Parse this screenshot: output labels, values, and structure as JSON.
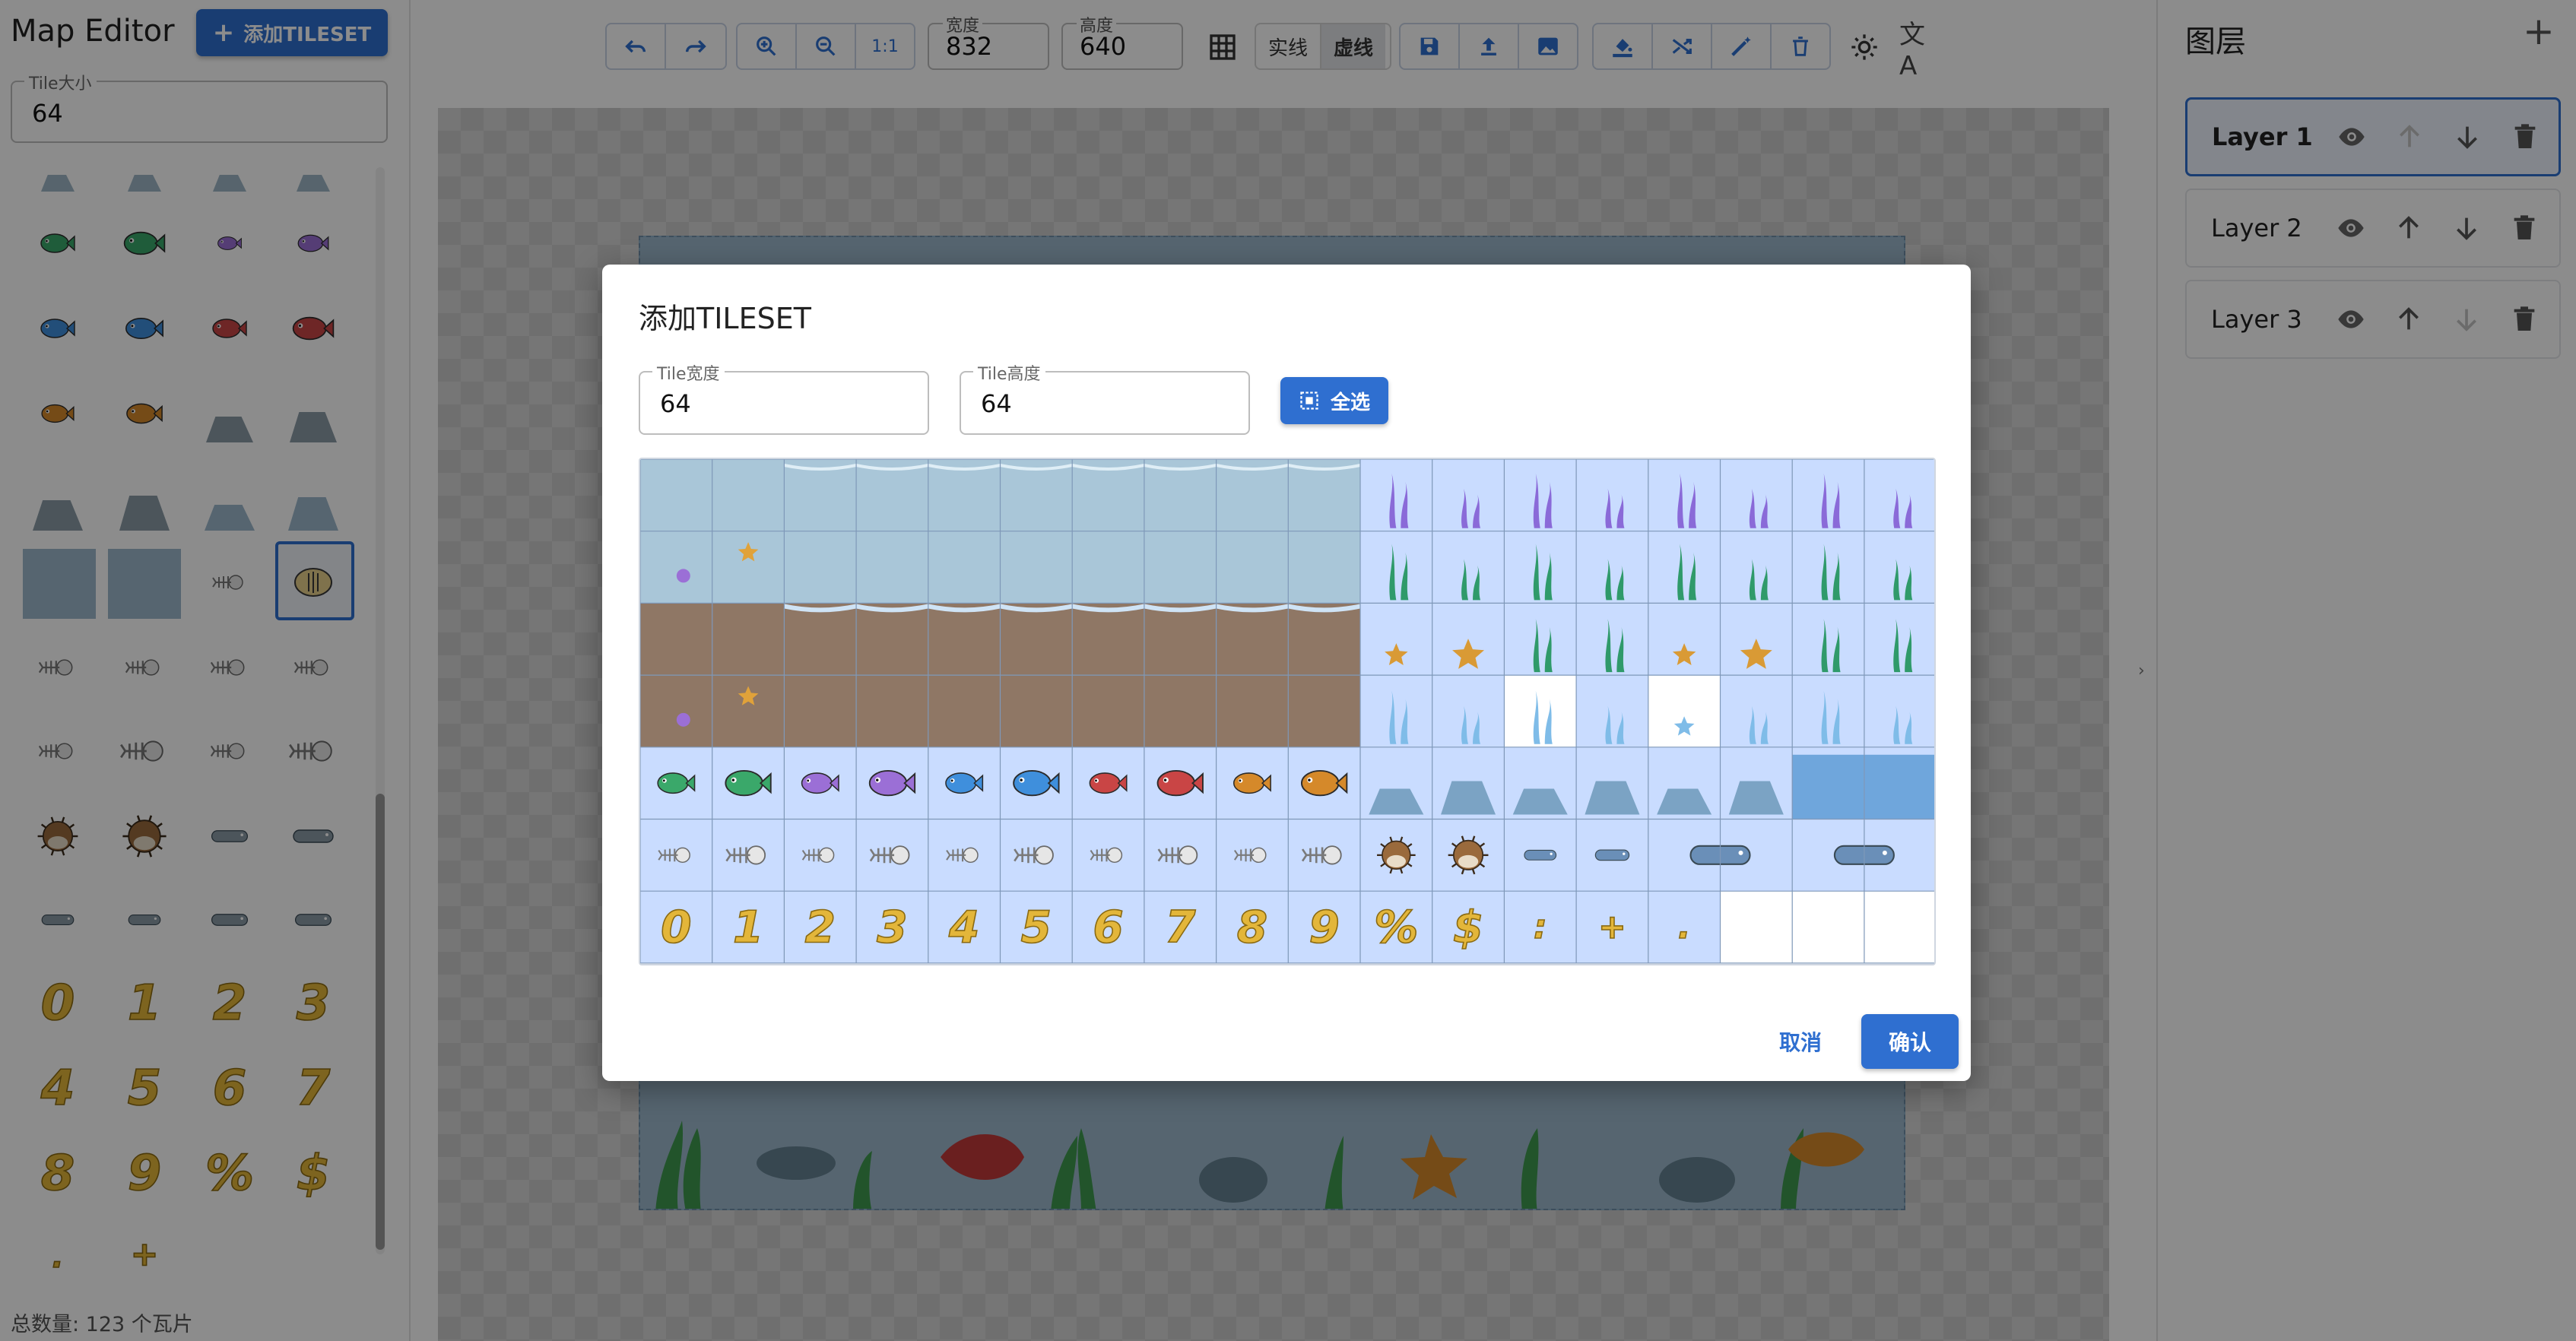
{
  "app": {
    "title": "Map Editor",
    "add_tileset_label": "添加TILESET"
  },
  "sidebar": {
    "tile_size": {
      "label": "Tile大小",
      "value": "64"
    },
    "total": "总数量: 123 个瓦片",
    "number_tiles": [
      "0",
      "1",
      "2",
      "3",
      "4",
      "5",
      "6",
      "7",
      "8",
      "9",
      "%",
      "$"
    ]
  },
  "toolbar": {
    "width": {
      "label": "宽度",
      "value": "832"
    },
    "height": {
      "label": "高度",
      "value": "640"
    },
    "zoom_reset": "1:1",
    "solid_label": "实线",
    "dashed_label": "虚线",
    "selected_line_style": "虚线",
    "icons": [
      "undo-icon",
      "redo-icon",
      "zoom-in-icon",
      "zoom-out-icon",
      "grid-icon",
      "save-icon",
      "upload-icon",
      "image-icon",
      "fill-icon",
      "shuffle-icon",
      "wand-icon",
      "delete-icon",
      "brightness-icon",
      "translate-icon"
    ]
  },
  "layers": {
    "title": "图层",
    "items": [
      {
        "name": "Layer 1",
        "active": true
      },
      {
        "name": "Layer 2",
        "active": false
      },
      {
        "name": "Layer 3",
        "active": false
      }
    ]
  },
  "modal": {
    "title": "添加TILESET",
    "tile_width": {
      "label": "Tile宽度",
      "value": "64"
    },
    "tile_height": {
      "label": "Tile高度",
      "value": "64"
    },
    "select_all_label": "全选",
    "cancel_label": "取消",
    "confirm_label": "确认",
    "digit_tiles": [
      "0",
      "1",
      "2",
      "3",
      "4",
      "5",
      "6",
      "7",
      "8",
      "9",
      "%",
      "$",
      ":",
      "+",
      "."
    ]
  },
  "colors": {
    "primary": "#2f6fd0",
    "tile_selected": "#c9dcff",
    "digit_gold": "#e3b63a"
  }
}
